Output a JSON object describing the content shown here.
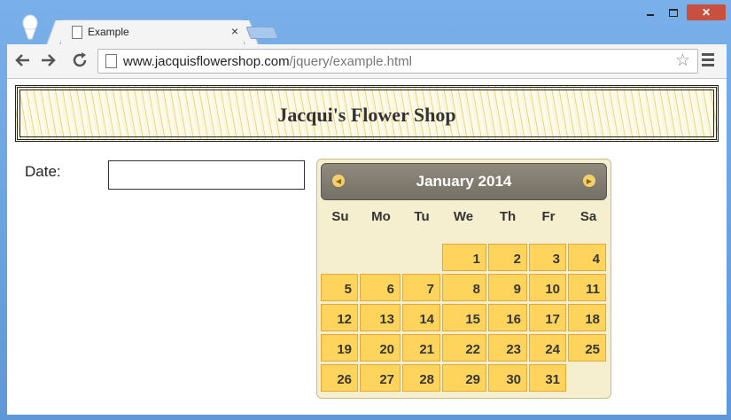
{
  "browser": {
    "tab_title": "Example",
    "tab_close": "×",
    "url_host": "www.jacquisflowershop.com",
    "url_path": "/jquery/example.html",
    "close_glyph": "✕"
  },
  "page": {
    "banner_title": "Jacqui's Flower Shop",
    "date_label": "Date:",
    "date_value": ""
  },
  "datepicker": {
    "month_title": "January 2014",
    "prev_glyph": "◀",
    "next_glyph": "▶",
    "weekdays": [
      "Su",
      "Mo",
      "Tu",
      "We",
      "Th",
      "Fr",
      "Sa"
    ],
    "first_weekday_index": 3,
    "days_in_month": 31,
    "colors": {
      "cell": "#fed45c",
      "header": "#7f7a6e",
      "background": "#f5efcf"
    }
  }
}
